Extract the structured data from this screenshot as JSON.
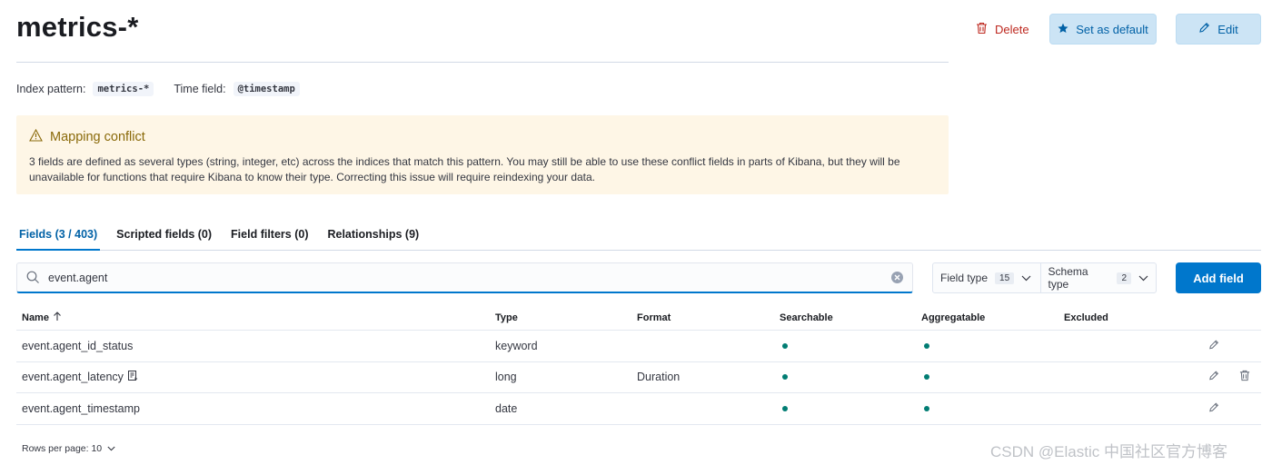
{
  "header": {
    "title": "metrics-*",
    "delete_label": "Delete",
    "set_default_label": "Set as default",
    "edit_label": "Edit"
  },
  "meta": {
    "index_pattern_label": "Index pattern:",
    "index_pattern_value": "metrics-*",
    "time_field_label": "Time field:",
    "time_field_value": "@timestamp"
  },
  "callout": {
    "title": "Mapping conflict",
    "body": "3 fields are defined as several types (string, integer, etc) across the indices that match this pattern. You may still be able to use these conflict fields in parts of Kibana, but they will be unavailable for functions that require Kibana to know their type. Correcting this issue will require reindexing your data."
  },
  "tabs": [
    {
      "label": "Fields (3 / 403)",
      "active": true
    },
    {
      "label": "Scripted fields (0)",
      "active": false
    },
    {
      "label": "Field filters (0)",
      "active": false
    },
    {
      "label": "Relationships (9)",
      "active": false
    }
  ],
  "search": {
    "value": "event.agent",
    "placeholder": "Search"
  },
  "filters": {
    "field_type_label": "Field type",
    "field_type_count": "15",
    "schema_type_label": "Schema type",
    "schema_type_count": "2"
  },
  "add_field_label": "Add field",
  "table": {
    "columns": {
      "name": "Name",
      "type": "Type",
      "format": "Format",
      "searchable": "Searchable",
      "aggregatable": "Aggregatable",
      "excluded": "Excluded"
    },
    "rows": [
      {
        "name": "event.agent_id_status",
        "type": "keyword",
        "format": "",
        "searchable": true,
        "aggregatable": true,
        "has_script_icon": false,
        "deletable": false
      },
      {
        "name": "event.agent_latency",
        "type": "long",
        "format": "Duration",
        "searchable": true,
        "aggregatable": true,
        "has_script_icon": true,
        "deletable": true
      },
      {
        "name": "event.agent_timestamp",
        "type": "date",
        "format": "",
        "searchable": true,
        "aggregatable": true,
        "has_script_icon": false,
        "deletable": false
      }
    ]
  },
  "pagination": {
    "rows_per_page_label": "Rows per page: 10"
  },
  "watermark": "CSDN @Elastic 中国社区官方博客",
  "colors": {
    "primary": "#0077cc",
    "danger": "#bd271e",
    "warning_bg": "#fef6e6",
    "success_dot": "#017d73"
  }
}
